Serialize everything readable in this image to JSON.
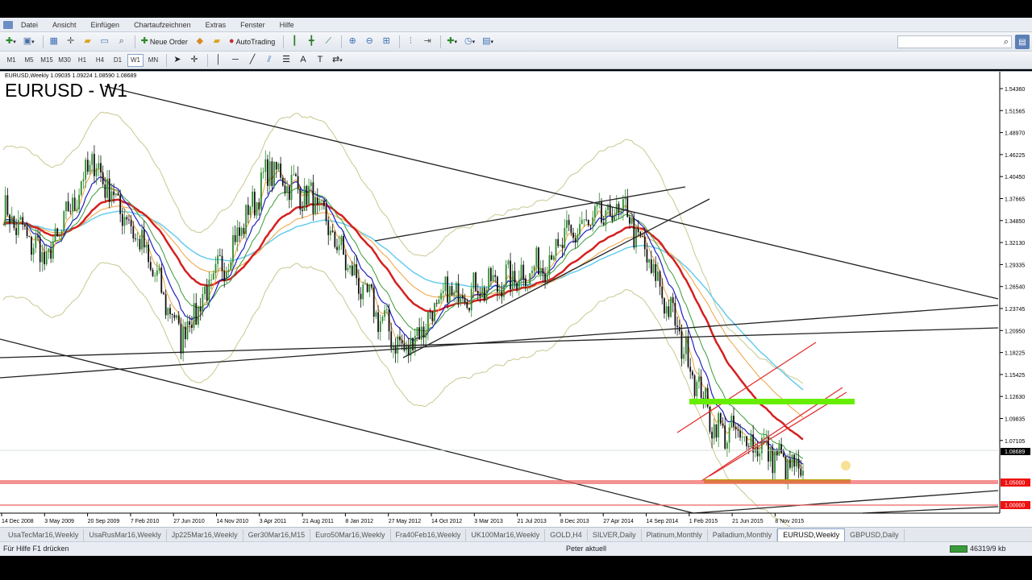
{
  "menu": [
    "Datei",
    "Ansicht",
    "Einfügen",
    "Chartaufzeichnen",
    "Extras",
    "Fenster",
    "Hilfe"
  ],
  "toolbar": {
    "new_order_label": "Neue Order",
    "autotrading_label": "AutoTrading",
    "search_placeholder": ""
  },
  "timeframes": [
    "M1",
    "M5",
    "M15",
    "M30",
    "H1",
    "H4",
    "D1",
    "W1",
    "MN"
  ],
  "active_timeframe": "W1",
  "chart": {
    "header_text": "EURUSD,Weekly  1.09035 1.09224 1.08590 1.08689",
    "title": "EURUSD - W1",
    "price_labels": [
      "1.54360",
      "1.51565",
      "1.48970",
      "1.46225",
      "1.40450",
      "1.37665",
      "1.34850",
      "1.32130",
      "1.29335",
      "1.26540",
      "1.23745",
      "1.20950",
      "1.18225",
      "1.15425",
      "1.12630",
      "1.09835",
      "1.07105"
    ],
    "current_price": "1.08689",
    "red_price_labels": [
      "1.05000",
      "1.00000"
    ],
    "date_labels": [
      "14 Dec 2008",
      "3 May 2009",
      "20 Sep 2009",
      "7 Feb 2010",
      "27 Jun 2010",
      "14 Nov 2010",
      "3 Apr 2011",
      "21 Aug 2011",
      "8 Jan 2012",
      "27 May 2012",
      "14 Oct 2012",
      "3 Mar 2013",
      "21 Jul 2013",
      "8 Dec 2013",
      "27 Apr 2014",
      "14 Sep 2014",
      "1 Feb 2015",
      "21 Jun 2015",
      "8 Nov 2015"
    ],
    "colors": {
      "bull": "#2e8b2e",
      "bear": "#111111",
      "ema_red": "#d42020",
      "ema_orange": "#f0a040",
      "ema_green": "#3a9a3a",
      "ema_blue": "#2020c0",
      "ema_cyan": "#66ccee",
      "bands": "#c8c890",
      "resistance_zone": "#66ee00",
      "support_zone": "#b7a400",
      "horizontal_red": "#ef6464",
      "price_tag_red": "#ee1111"
    }
  },
  "chart_data": {
    "type": "line",
    "instrument": "EURUSD",
    "timeframe": "Weekly",
    "ylim": [
      1.032,
      1.556
    ],
    "x": [
      "14 Dec 2008",
      "3 May 2009",
      "20 Sep 2009",
      "7 Feb 2010",
      "27 Jun 2010",
      "14 Nov 2010",
      "3 Apr 2011",
      "21 Aug 2011",
      "8 Jan 2012",
      "27 May 2012",
      "14 Oct 2012",
      "3 Mar 2013",
      "21 Jul 2013",
      "8 Dec 2013",
      "27 Apr 2014",
      "14 Sep 2014",
      "1 Feb 2015",
      "21 Jun 2015",
      "8 Nov 2015"
    ],
    "series": [
      {
        "values": [
          1.39,
          1.33,
          1.45,
          1.36,
          1.24,
          1.33,
          1.44,
          1.4,
          1.3,
          1.22,
          1.29,
          1.3,
          1.32,
          1.37,
          1.39,
          1.27,
          1.13,
          1.11,
          1.07
        ]
      }
    ],
    "horizontal_levels": [
      1.05,
      1.0
    ]
  },
  "tabs": [
    "UsaTecMar16,Weekly",
    "UsaRusMar16,Weekly",
    "Jp225Mar16,Weekly",
    "Ger30Mar16,M15",
    "Euro50Mar16,Weekly",
    "Fra40Feb16,Weekly",
    "UK100Mar16,Weekly",
    "GOLD,H4",
    "SILVER,Daily",
    "Platinum,Monthly",
    "Palladium,Monthly",
    "EURUSD,Weekly",
    "GBPUSD,Daily"
  ],
  "active_tab": "EURUSD,Weekly",
  "status": {
    "help_text": "Für Hilfe F1 drücken",
    "profile": "Peter aktuell",
    "traffic": "46319/9 kb"
  }
}
